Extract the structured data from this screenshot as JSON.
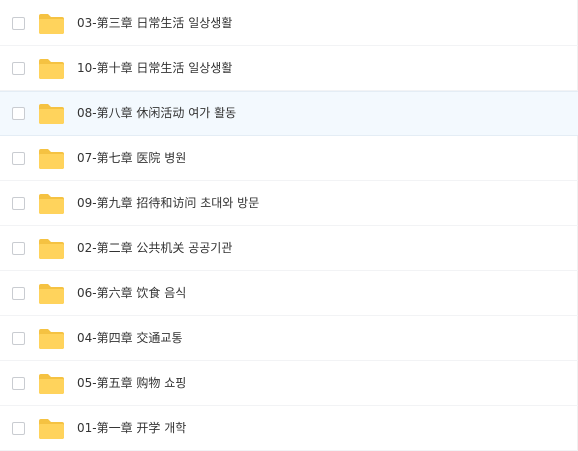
{
  "file_list": {
    "hovered_item": "08-第八章 休闲活动 여가 활동",
    "folder_color": "#ffd35c",
    "folder_tab_color": "#f5c242",
    "items": [
      {
        "name": "03-第三章 日常生活 일상생활",
        "icon": "folder-icon",
        "checked": false
      },
      {
        "name": "10-第十章 日常生活 일상생활",
        "icon": "folder-icon",
        "checked": false
      },
      {
        "name": "08-第八章 休闲活动 여가 활동",
        "icon": "folder-icon",
        "checked": false
      },
      {
        "name": "07-第七章 医院 병원",
        "icon": "folder-icon",
        "checked": false
      },
      {
        "name": "09-第九章 招待和访问 초대와 방문",
        "icon": "folder-icon",
        "checked": false
      },
      {
        "name": "02-第二章 公共机关 공공기관",
        "icon": "folder-icon",
        "checked": false
      },
      {
        "name": "06-第六章 饮食 음식",
        "icon": "folder-icon",
        "checked": false
      },
      {
        "name": "04-第四章 交通교통",
        "icon": "folder-icon",
        "checked": false
      },
      {
        "name": "05-第五章 购物 쇼핑",
        "icon": "folder-icon",
        "checked": false
      },
      {
        "name": "01-第一章 开学 개학",
        "icon": "folder-icon",
        "checked": false
      }
    ]
  }
}
